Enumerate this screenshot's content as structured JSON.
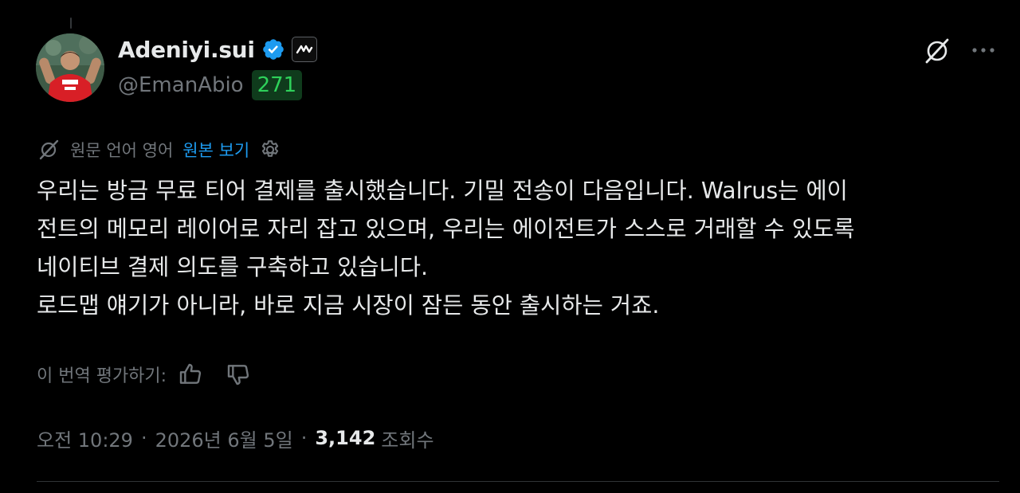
{
  "author": {
    "display_name": "Adeniyi.sui",
    "handle": "@EmanAbio",
    "score_badge": "271",
    "avatar_icon": "profile-photo",
    "verified_icon": "verified-check-icon",
    "affiliate_icon": "affiliate-logo-icon"
  },
  "actions": {
    "grok_icon": "grok-icon",
    "more_icon": "more-icon"
  },
  "translation": {
    "icon": "translate-globe-icon",
    "label": "원문 언어 영어",
    "show_original": "원본 보기",
    "settings_icon": "gear-icon"
  },
  "tweet": {
    "lines": [
      "우리는 방금 무료 티어 결제를 출시했습니다. 기밀 전송이 다음입니다. Walrus는 에이",
      "전트의 메모리 레이어로 자리 잡고 있으며, 우리는 에이전트가 스스로 거래할 수 있도록",
      "네이티브 결제 의도를 구축하고 있습니다.",
      "로드맵 얘기가 아니라, 바로 지금 시장이 잠든 동안 출시하는 거죠."
    ]
  },
  "rating": {
    "label": "이 번역 평가하기:",
    "like_icon": "thumbs-up-icon",
    "dislike_icon": "thumbs-down-icon"
  },
  "meta": {
    "time": "오전 10:29",
    "separator": "·",
    "date": "2026년 6월 5일",
    "views_count": "3,142",
    "views_label": "조회수"
  },
  "colors": {
    "background": "#000000",
    "text": "#e7e9ea",
    "muted": "#71767b",
    "link": "#1d9bf0",
    "verified": "#1d9bf0",
    "score_bg": "#0f3b1c",
    "score_text": "#2ed15a"
  }
}
